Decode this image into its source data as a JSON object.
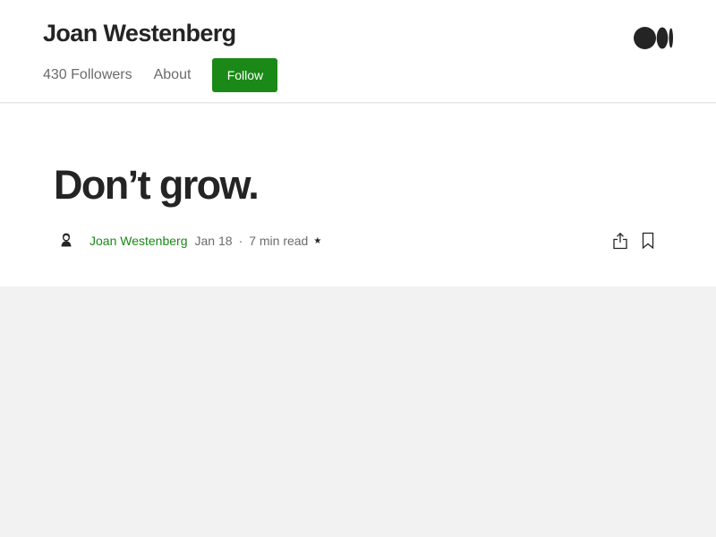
{
  "header": {
    "author_name": "Joan Westenberg",
    "followers_label": "430 Followers",
    "about_label": "About",
    "follow_label": "Follow",
    "logo_icon": "medium-logo-icon"
  },
  "article": {
    "title": "Don’t grow.",
    "author": "Joan Westenberg",
    "date": "Jan 18",
    "separator": "·",
    "read_time": "7 min read",
    "member_star": "★",
    "avatar_icon": "avatar",
    "share_icon": "share-icon",
    "bookmark_icon": "bookmark-icon"
  },
  "colors": {
    "accent_green": "#1a8917",
    "text_primary": "#242424",
    "text_secondary": "#6b6b6b",
    "page_background": "#f2f2f2"
  }
}
